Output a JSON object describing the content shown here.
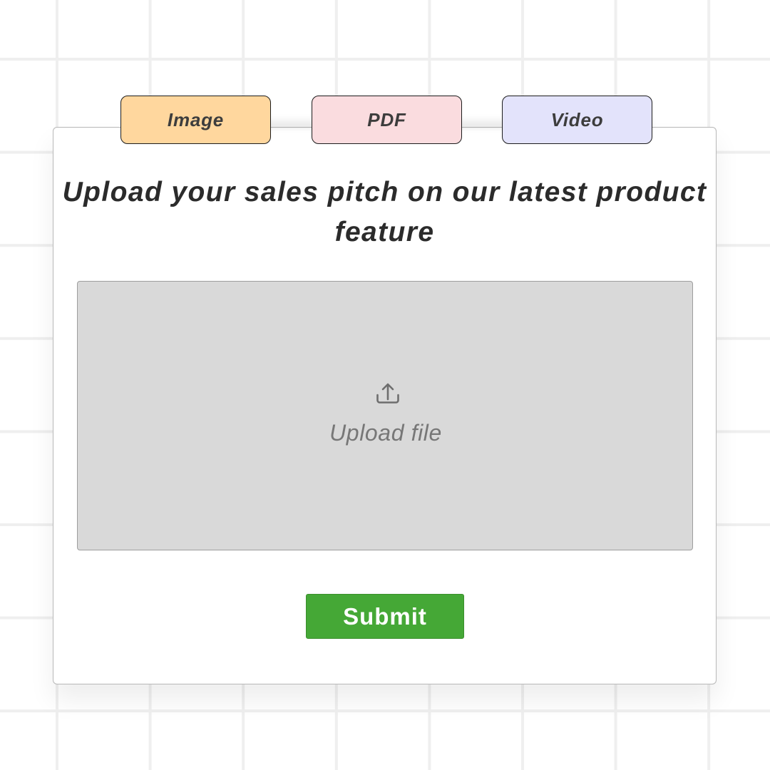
{
  "tabs": [
    {
      "label": "Image",
      "color": "#ffd79e"
    },
    {
      "label": "PDF",
      "color": "#fadcdf"
    },
    {
      "label": "Video",
      "color": "#e3e3fb"
    }
  ],
  "heading": "Upload your sales pitch on our latest product feature",
  "upload": {
    "icon": "upload-icon",
    "label": "Upload file"
  },
  "submit": {
    "label": "Submit",
    "color": "#45a836"
  }
}
